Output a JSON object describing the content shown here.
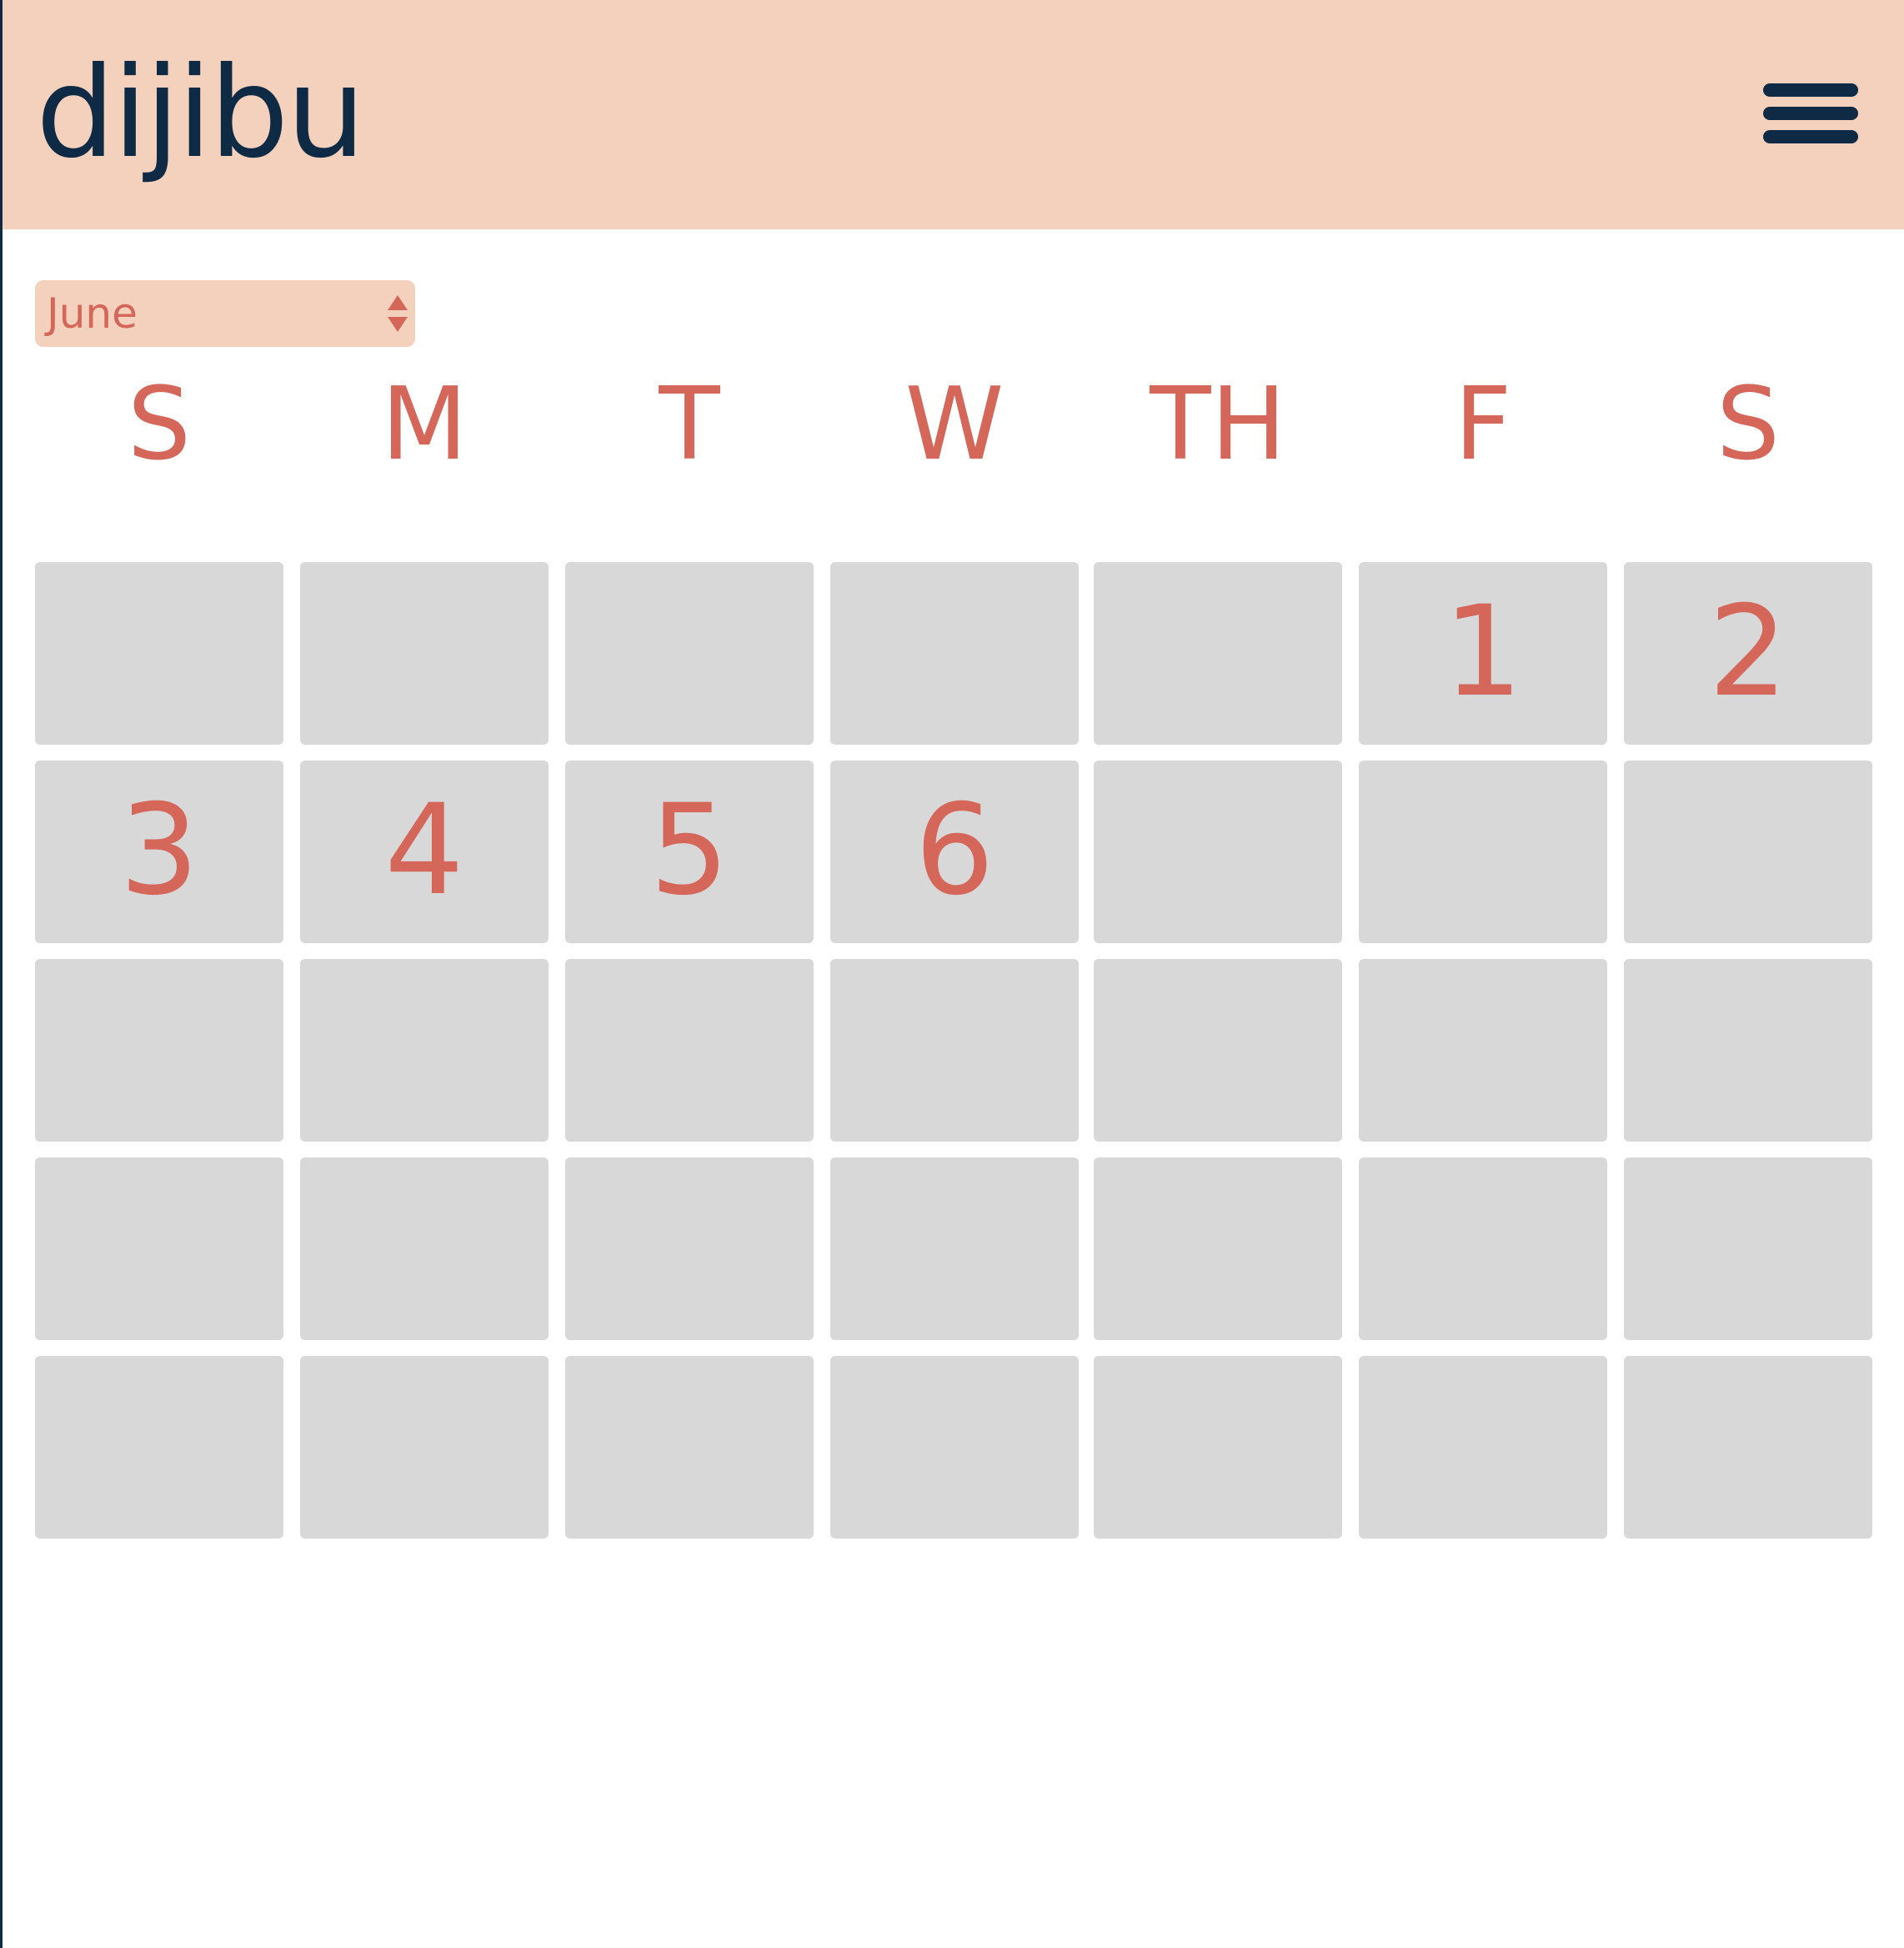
{
  "app": {
    "name": "dijibu"
  },
  "colors": {
    "header_bg": "#f4d1bc",
    "brand": "#0f2a44",
    "accent": "#d4665a",
    "cell_bg": "#d8d8d8"
  },
  "icons": {
    "menu": "hamburger-icon",
    "select": "updown-arrows-icon"
  },
  "month_select": {
    "value": "June"
  },
  "weekdays": [
    "S",
    "M",
    "T",
    "W",
    "TH",
    "F",
    "S"
  ],
  "calendar": {
    "days": [
      "",
      "",
      "",
      "",
      "",
      "1",
      "2",
      "3",
      "4",
      "5",
      "6",
      "",
      "",
      "",
      "",
      "",
      "",
      "",
      "",
      "",
      "",
      "",
      "",
      "",
      "",
      "",
      "",
      "",
      "",
      "",
      "",
      "",
      "",
      "",
      ""
    ]
  }
}
